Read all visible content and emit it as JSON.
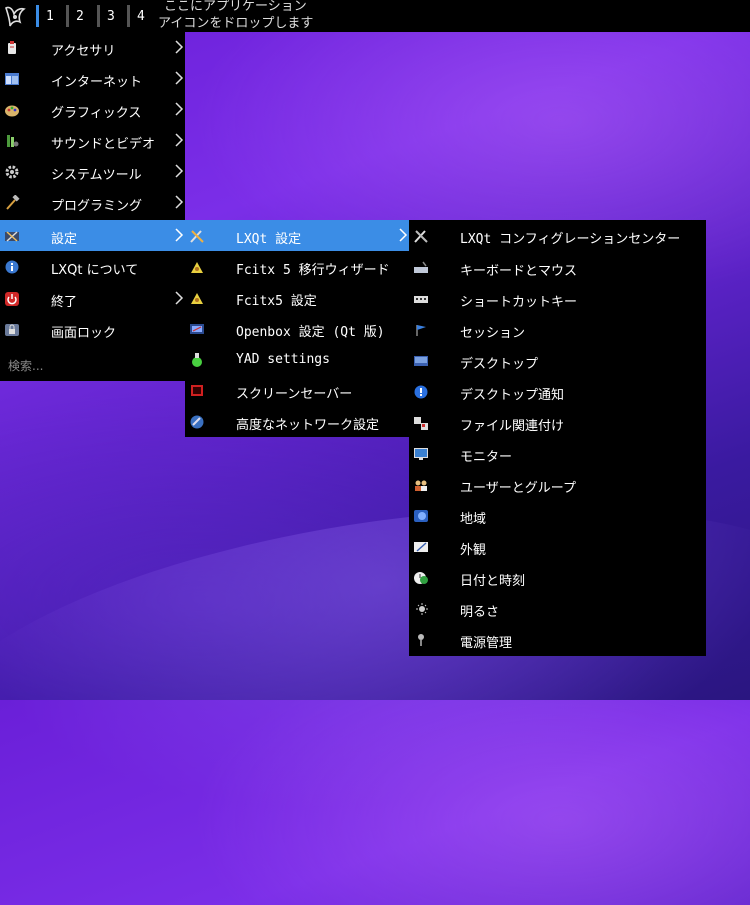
{
  "panel": {
    "workspaces": [
      "1",
      "2",
      "3",
      "4"
    ],
    "quicklaunch_hint_line1": "ここにアプリケーション",
    "quicklaunch_hint_line2": "アイコンをドロップします"
  },
  "main_menu": {
    "items": [
      {
        "label": "アクセサリ",
        "icon": "accessories-icon",
        "submenu": true
      },
      {
        "label": "インターネット",
        "icon": "internet-icon",
        "submenu": true
      },
      {
        "label": "グラフィックス",
        "icon": "graphics-icon",
        "submenu": true
      },
      {
        "label": "サウンドとビデオ",
        "icon": "multimedia-icon",
        "submenu": true
      },
      {
        "label": "システムツール",
        "icon": "system-tools-icon",
        "submenu": true
      },
      {
        "label": "プログラミング",
        "icon": "programming-icon",
        "submenu": true
      },
      {
        "label": "設定",
        "icon": "settings-icon",
        "submenu": true,
        "highlighted": true
      },
      {
        "label": "LXQt について",
        "icon": "about-icon",
        "submenu": false
      },
      {
        "label": "終了",
        "icon": "power-icon",
        "submenu": true
      },
      {
        "label": "画面ロック",
        "icon": "lock-icon",
        "submenu": false
      }
    ],
    "search_placeholder": "検索..."
  },
  "settings_menu": {
    "items": [
      {
        "label": "LXQt 設定",
        "icon": "lxqt-settings-icon",
        "submenu": true,
        "highlighted": true
      },
      {
        "label": "Fcitx 5 移行ウィザード",
        "icon": "fcitx-icon",
        "submenu": false
      },
      {
        "label": "Fcitx5 設定",
        "icon": "fcitx-config-icon",
        "submenu": false
      },
      {
        "label": "Openbox 設定 (Qt 版)",
        "icon": "openbox-icon",
        "submenu": false
      },
      {
        "label": "YAD settings",
        "icon": "yad-icon",
        "submenu": false
      },
      {
        "label": "スクリーンセーバー",
        "icon": "screensaver-icon",
        "submenu": false
      },
      {
        "label": "高度なネットワーク設定",
        "icon": "network-icon",
        "submenu": false
      }
    ]
  },
  "lxqt_menu": {
    "items": [
      {
        "label": "LXQt コンフィグレーションセンター",
        "icon": "config-center-icon"
      },
      {
        "label": "キーボードとマウス",
        "icon": "keyboard-mouse-icon"
      },
      {
        "label": "ショートカットキー",
        "icon": "shortcut-keys-icon"
      },
      {
        "label": "セッション",
        "icon": "session-icon"
      },
      {
        "label": "デスクトップ",
        "icon": "desktop-icon"
      },
      {
        "label": "デスクトップ通知",
        "icon": "notification-icon"
      },
      {
        "label": "ファイル関連付け",
        "icon": "file-association-icon"
      },
      {
        "label": "モニター",
        "icon": "monitor-icon"
      },
      {
        "label": "ユーザーとグループ",
        "icon": "users-groups-icon"
      },
      {
        "label": "地域",
        "icon": "locale-icon"
      },
      {
        "label": "外観",
        "icon": "appearance-icon"
      },
      {
        "label": "日付と時刻",
        "icon": "date-time-icon"
      },
      {
        "label": "明るさ",
        "icon": "brightness-icon"
      },
      {
        "label": "電源管理",
        "icon": "power-management-icon"
      }
    ]
  },
  "colors": {
    "highlight": "#3b8de6",
    "menu_bg": "#000000"
  }
}
